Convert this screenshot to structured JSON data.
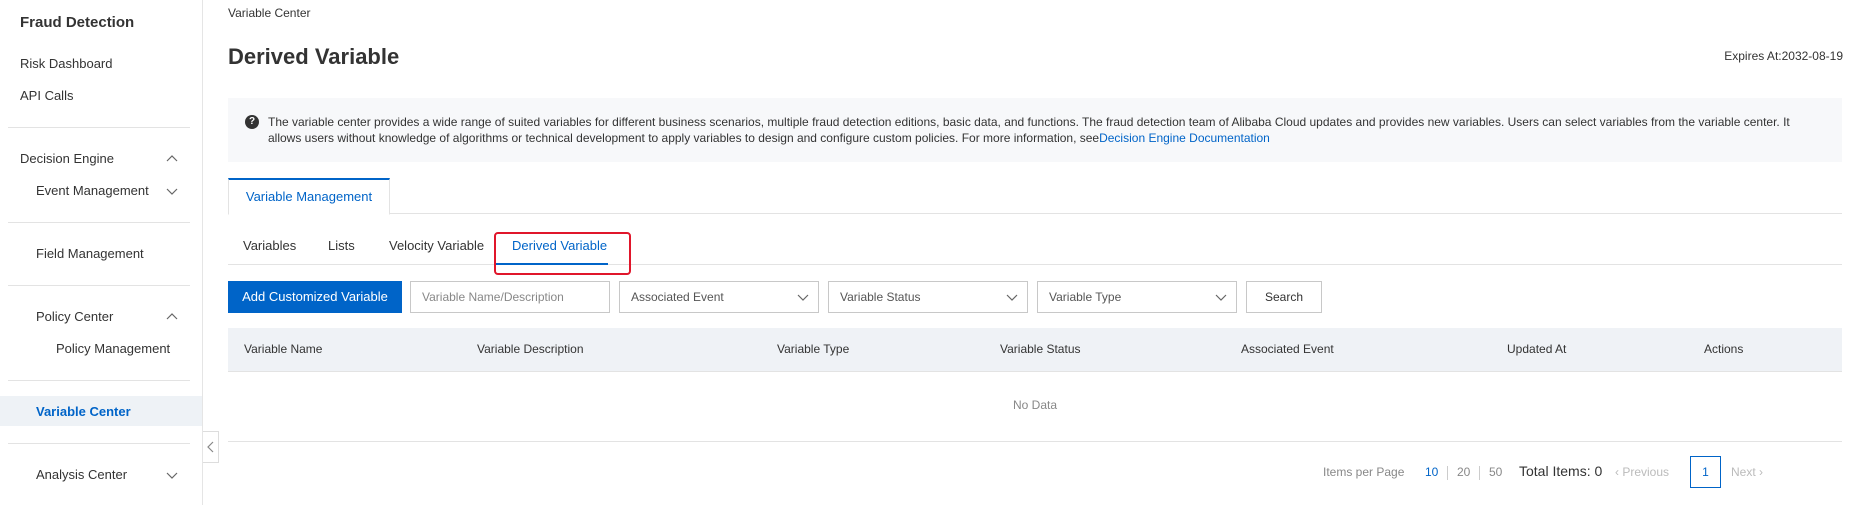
{
  "sidebar": {
    "title": "Fraud Detection",
    "items": [
      {
        "label": "Risk Dashboard"
      },
      {
        "label": "API Calls"
      },
      {
        "label": "Decision Engine"
      },
      {
        "label": "Event Management"
      },
      {
        "label": "Field Management"
      },
      {
        "label": "Policy Center"
      },
      {
        "label": "Policy Management"
      },
      {
        "label": "Variable Center"
      },
      {
        "label": "Analysis Center"
      }
    ]
  },
  "header": {
    "breadcrumb": "Variable Center",
    "title": "Derived Variable",
    "expires": "Expires At:2032-08-19"
  },
  "notice": {
    "text": "The variable center provides a wide range of suited variables for different business scenarios, multiple fraud detection editions, basic data, and functions. The fraud detection team of Alibaba Cloud updates and provides new variables. Users can select variables from the variable center. It allows users without knowledge of algorithms or technical development to apply variables to design and configure custom policies. For more information, see",
    "link": "Decision Engine Documentation"
  },
  "main_tab": "Variable Management",
  "subtabs": [
    "Variables",
    "Lists",
    "Velocity Variable",
    "Derived Variable"
  ],
  "toolbar": {
    "add_button": "Add Customized Variable",
    "search_placeholder": "Variable Name/Description",
    "associated_event": "Associated Event",
    "variable_status": "Variable Status",
    "variable_type": "Variable Type",
    "search_button": "Search"
  },
  "table": {
    "columns": [
      "Variable Name",
      "Variable Description",
      "Variable Type",
      "Variable Status",
      "Associated Event",
      "Updated At",
      "Actions"
    ],
    "empty_text": "No Data"
  },
  "pagination": {
    "items_per_page_label": "Items per Page",
    "sizes": [
      "10",
      "20",
      "50"
    ],
    "total": "Total Items: 0",
    "previous": "Previous",
    "current_page": "1",
    "next": "Next"
  }
}
